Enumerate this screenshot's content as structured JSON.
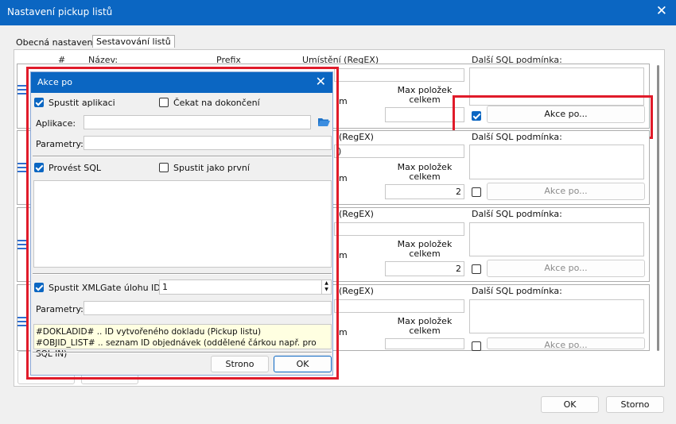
{
  "window": {
    "title": "Nastavení pickup listů"
  },
  "tabs": [
    {
      "label": "Obecná nastavení"
    },
    {
      "label": "Sestavování listů"
    }
  ],
  "columns": {
    "num": "#",
    "name": "Název:",
    "prefix": "Prefix",
    "location": "Umístění (RegEX)",
    "extra_sql": "Další SQL podmínka:"
  },
  "rows": [
    {
      "location_peek": "m",
      "max_items_label": "Max položek\ncelkem",
      "max_items_value": "",
      "action_button": "Akce po...",
      "checked": true
    },
    {
      "location_peek": "(RegEX)",
      "location_value_peek": ")",
      "max_items_label": "Max položek\ncelkem",
      "max_items_value": "2",
      "action_button": "Akce po...",
      "checked": false
    },
    {
      "location_peek": "(RegEX)",
      "max_items_label": "Max položek\ncelkem",
      "max_items_value": "2",
      "action_button": "Akce po...",
      "checked": false
    },
    {
      "location_peek": "(RegEX)",
      "max_items_label": "Max položek\ncelkem",
      "max_items_value": "",
      "action_button": "Akce po...",
      "checked": false
    }
  ],
  "extra_sql_label": "Další SQL podmínka:",
  "footer": {
    "ok": "OK",
    "cancel": "Storno"
  },
  "dialog": {
    "title": "Akce po",
    "run_app": "Spustit aplikaci",
    "wait_finish": "Čekat na dokončení",
    "app_label": "Aplikace:",
    "params_label": "Parametry:",
    "run_sql": "Provést SQL",
    "run_first": "Spustit jako první",
    "xmlgate": "Spustit XMLGate úlohu ID:",
    "xmlgate_value": "1",
    "params2_label": "Parametry:",
    "hint_line1": "#DOKLADID# .. ID vytvořeného dokladu (Pickup listu)",
    "hint_line2": "#OBJID_LIST# .. seznam ID objednávek (oddělené čárkou např. pro SQL IN)",
    "cancel": "Strono",
    "ok": "OK"
  },
  "colors": {
    "accent": "#0b66c2",
    "highlight": "#e01b2a"
  }
}
